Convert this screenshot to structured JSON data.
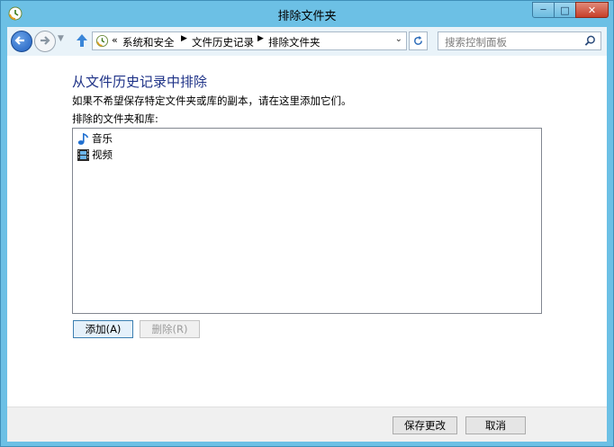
{
  "window": {
    "title": "排除文件夹",
    "min_glyph": "─",
    "max_glyph": "□",
    "close_glyph": "✕"
  },
  "address_bar": {
    "overflow": "«",
    "crumbs": [
      "系统和安全",
      "文件历史记录",
      "排除文件夹"
    ],
    "sep": "▶",
    "dropdown": "⌄"
  },
  "search": {
    "placeholder": "搜索控制面板"
  },
  "main": {
    "heading": "从文件历史记录中排除",
    "description": "如果不希望保存特定文件夹或库的副本，请在这里添加它们。",
    "list_label": "排除的文件夹和库:",
    "items": [
      {
        "label": "音乐",
        "icon": "music-note-icon"
      },
      {
        "label": "视频",
        "icon": "video-film-icon"
      }
    ],
    "add_label": "添加(A)",
    "remove_label": "删除(R)"
  },
  "footer": {
    "save_label": "保存更改",
    "cancel_label": "取消"
  },
  "colors": {
    "frame": "#6cc0e5",
    "heading": "#1e3287",
    "close": "#c7402a"
  }
}
